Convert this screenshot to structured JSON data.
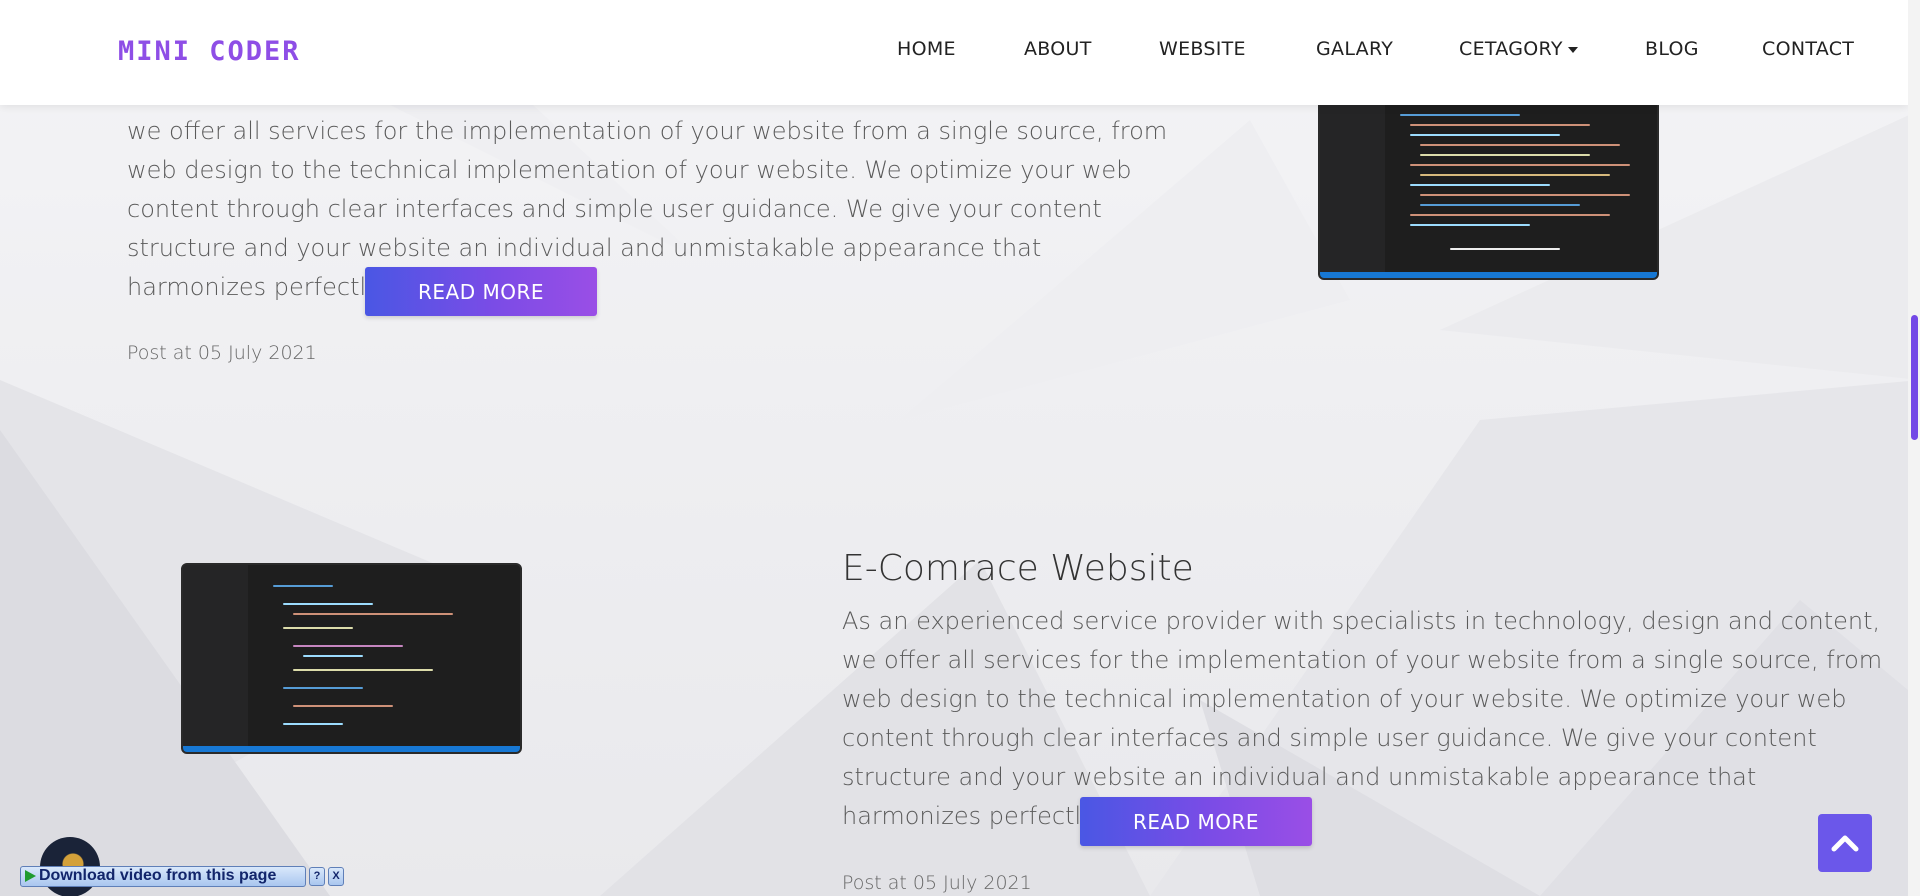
{
  "header": {
    "logo": "MINI CODER",
    "nav": [
      {
        "label": "HOME"
      },
      {
        "label": "ABOUT"
      },
      {
        "label": "WEBSITE"
      },
      {
        "label": "GALARY"
      },
      {
        "label": "CETAGORY"
      },
      {
        "label": "BLOG"
      },
      {
        "label": "CONTACT"
      }
    ]
  },
  "posts": [
    {
      "title": "",
      "body_lines": [
        "we offer all services for the implementation of your website from a single source, from",
        "web design to the technical implementation of your website. We optimize your web",
        "content through clear interfaces and simple user guidance. We give your content",
        "structure and your website an individual and unmistakable appearance that",
        "harmonizes perfectly."
      ],
      "read_more": "READ MORE",
      "date": "Post at 05 July 2021"
    },
    {
      "title": "E-Comrace Website",
      "body_lines": [
        "As an experienced service provider with specialists in technology, design and content,",
        "we offer all services for the implementation of your website from a single source, from",
        "web design to the technical implementation of your website. We optimize your web",
        "content through clear interfaces and simple user guidance. We give your content",
        "structure and your website an individual and unmistakable appearance that",
        "harmonizes perfectly."
      ],
      "read_more": "READ MORE",
      "date": "Post at 05 July 2021"
    }
  ],
  "download_bar": {
    "label": "Download video from this page",
    "help": "?",
    "close": "X"
  },
  "icons": {
    "back_to_top": "chevron-up-icon",
    "caret": "caret-down-icon",
    "play": "play-icon"
  },
  "colors": {
    "brand": "#8e4ee6",
    "button_start": "#4a57e4",
    "button_end": "#9a4ee6",
    "scroll_thumb": "#7348e6",
    "to_top": "#6b57ea"
  }
}
